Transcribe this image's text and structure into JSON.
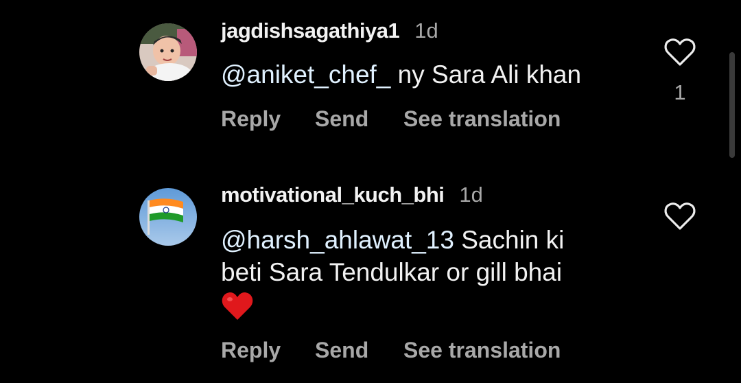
{
  "comments": [
    {
      "username": "jagdishsagathiya1",
      "time": "1d",
      "mention": "@aniket_chef_",
      "text": " ny Sara Ali khan",
      "actions": {
        "reply": "Reply",
        "send": "Send",
        "translate": "See translation"
      },
      "like_count": "1",
      "avatar_icon": "baby-photo-avatar"
    },
    {
      "username": "motivational_kuch_bhi",
      "time": "1d",
      "mention": "@harsh_ahlawat_13",
      "text_line1": " Sachin ki",
      "text_line2": "beti Sara Tendulkar or gill bhai",
      "emoji": "❤️",
      "actions": {
        "reply": "Reply",
        "send": "Send",
        "translate": "See translation"
      },
      "avatar_icon": "indian-flag-avatar"
    }
  ],
  "colors": {
    "background": "#000000",
    "text": "#f2f2f2",
    "muted": "#a8a8a8",
    "heart": "#e0181c"
  }
}
